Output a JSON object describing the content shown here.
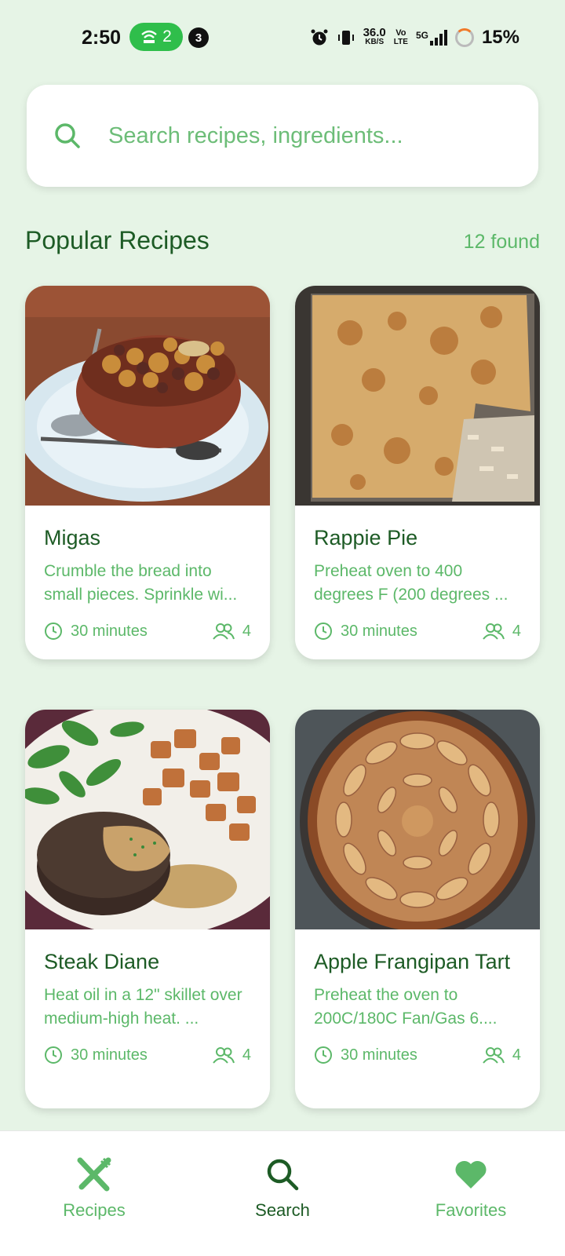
{
  "status_bar": {
    "time": "2:50",
    "wifi_count": "2",
    "notification_count": "3",
    "net_speed_value": "36.0",
    "net_speed_unit": "KB/S",
    "volte_top": "Vo",
    "volte_bottom": "LTE",
    "network_type": "5G",
    "battery_percent": "15%"
  },
  "search": {
    "placeholder": "Search recipes, ingredients..."
  },
  "section": {
    "title": "Popular Recipes",
    "count_text": "12 found"
  },
  "recipes": [
    {
      "title": "Migas",
      "description": "Crumble the bread into small pieces. Sprinkle wi...",
      "time": "30 minutes",
      "servings": "4",
      "image": "migas-bowl-photo"
    },
    {
      "title": "Rappie Pie",
      "description": "Preheat oven to 400 degrees F (200 degrees ...",
      "time": "30 minutes",
      "servings": "4",
      "image": "rappie-pie-photo"
    },
    {
      "title": "Steak Diane",
      "description": "Heat oil in a 12\" skillet over medium-high heat. ...",
      "time": "30 minutes",
      "servings": "4",
      "image": "steak-diane-photo"
    },
    {
      "title": "Apple Frangipan Tart",
      "description": "Preheat the oven to 200C/180C Fan/Gas 6....",
      "time": "30 minutes",
      "servings": "4",
      "image": "apple-tart-photo"
    }
  ],
  "bottom_nav": {
    "items": [
      {
        "label": "Recipes",
        "icon": "fork-knife-icon",
        "active": false
      },
      {
        "label": "Search",
        "icon": "search-icon",
        "active": true
      },
      {
        "label": "Favorites",
        "icon": "heart-icon",
        "active": false
      }
    ]
  },
  "colors": {
    "background": "#e6f4e6",
    "primary_dark": "#1d5b25",
    "primary_light": "#5cb869",
    "card": "#ffffff"
  }
}
